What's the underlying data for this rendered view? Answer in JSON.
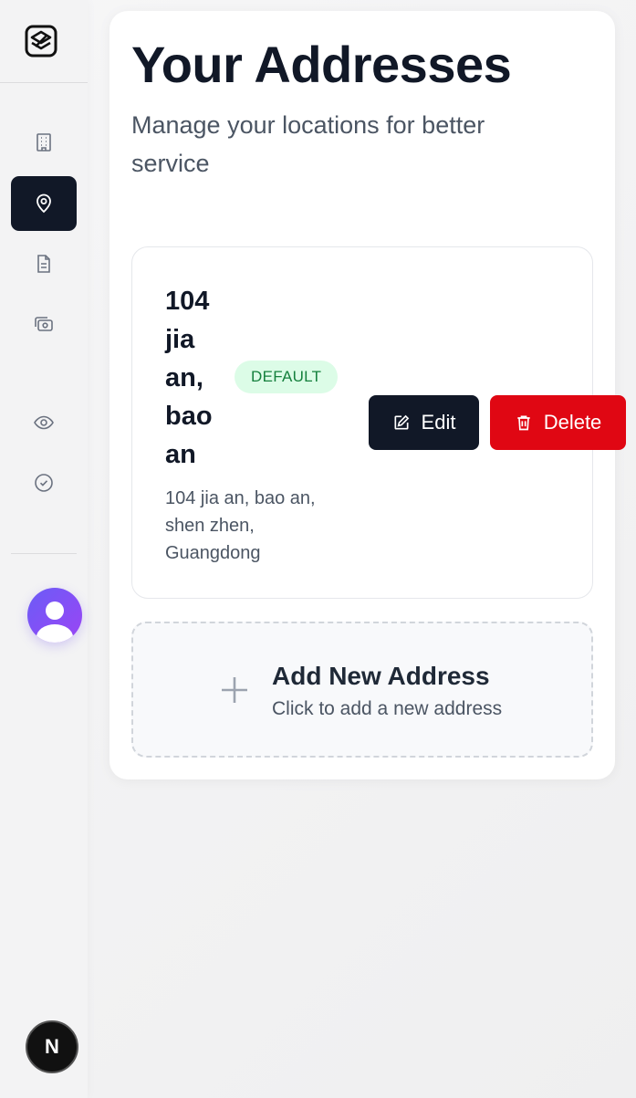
{
  "sidebar": {
    "logo": "app-logo",
    "nav_items": [
      {
        "name": "building-icon",
        "active": false
      },
      {
        "name": "location-pin-icon",
        "active": true
      },
      {
        "name": "document-icon",
        "active": false
      },
      {
        "name": "payment-icon",
        "active": false
      },
      {
        "name": "eye-icon",
        "active": false
      },
      {
        "name": "check-circle-icon",
        "active": false
      }
    ],
    "next_badge": "N"
  },
  "page": {
    "title": "Your Addresses",
    "subtitle": "Manage your locations for better service"
  },
  "addresses": [
    {
      "name": "104 jia an, bao an",
      "badge": "DEFAULT",
      "detail": "104 jia an, bao an, shen zhen, Guangdong",
      "edit_label": "Edit",
      "delete_label": "Delete"
    }
  ],
  "add_address": {
    "title": "Add New Address",
    "subtitle": "Click to add a new address"
  },
  "colors": {
    "primary": "#111827",
    "danger": "#e00713",
    "badge_bg": "#dcfce7",
    "badge_text": "#15803d",
    "avatar_gradient_start": "#6b5cf6",
    "avatar_gradient_end": "#9b45f5"
  }
}
